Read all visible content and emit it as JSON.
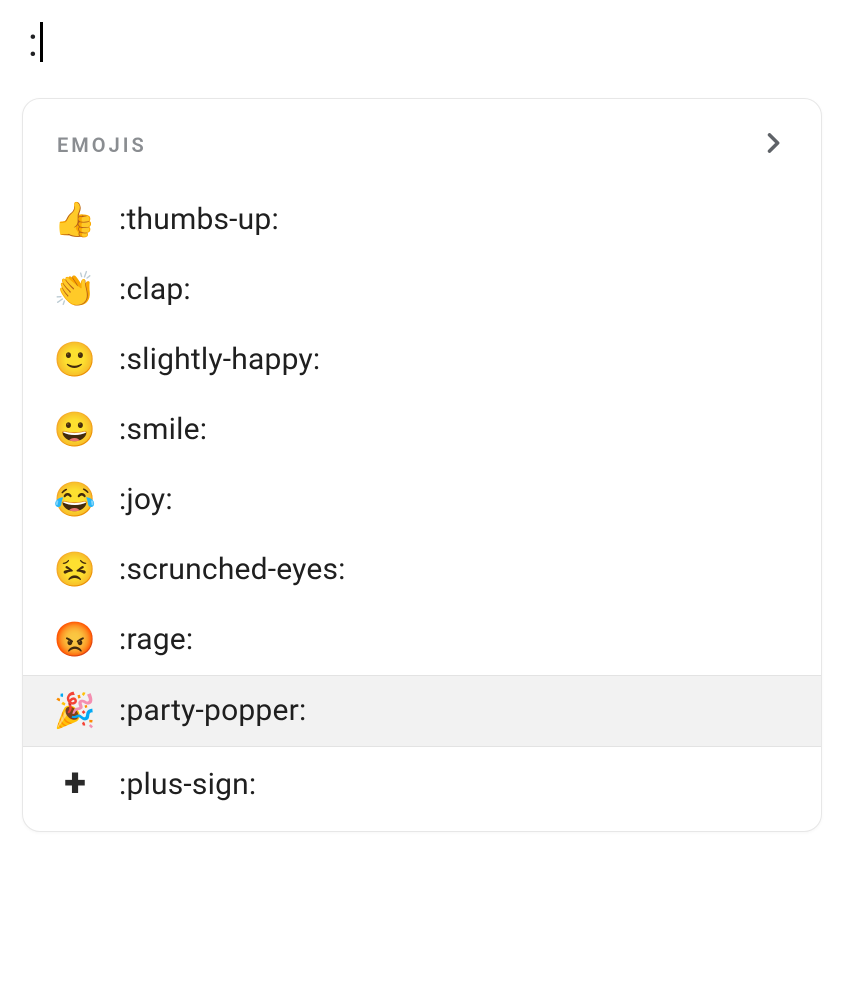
{
  "input": {
    "typed": ":"
  },
  "popover": {
    "header_label": "EMOJIS",
    "items": [
      {
        "glyph": "👍",
        "code": ":thumbs-up:",
        "highlighted": false,
        "name": "thumbs-up"
      },
      {
        "glyph": "👏",
        "code": ":clap:",
        "highlighted": false,
        "name": "clap"
      },
      {
        "glyph": "🙂",
        "code": ":slightly-happy:",
        "highlighted": false,
        "name": "slightly-happy"
      },
      {
        "glyph": "😀",
        "code": ":smile:",
        "highlighted": false,
        "name": "smile"
      },
      {
        "glyph": "😂",
        "code": ":joy:",
        "highlighted": false,
        "name": "joy"
      },
      {
        "glyph": "😣",
        "code": ":scrunched-eyes:",
        "highlighted": false,
        "name": "scrunched-eyes"
      },
      {
        "glyph": "😡",
        "code": ":rage:",
        "highlighted": false,
        "name": "rage"
      },
      {
        "glyph": "🎉",
        "code": ":party-popper:",
        "highlighted": true,
        "name": "party-popper"
      },
      {
        "glyph": "+",
        "code": ":plus-sign:",
        "highlighted": false,
        "name": "plus-sign",
        "plus_style": true
      }
    ]
  }
}
